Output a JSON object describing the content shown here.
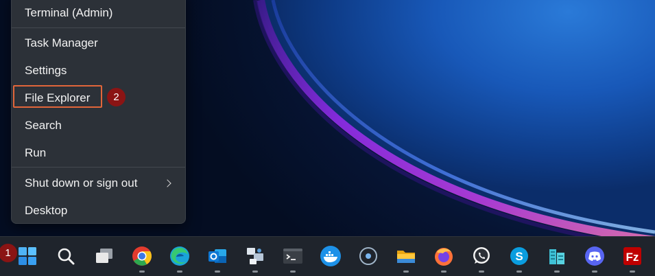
{
  "menu": {
    "items": [
      {
        "label": "Terminal (Admin)"
      },
      {
        "label": "Task Manager"
      },
      {
        "label": "Settings"
      },
      {
        "label": "File Explorer"
      },
      {
        "label": "Search"
      },
      {
        "label": "Run"
      },
      {
        "label": "Shut down or sign out"
      },
      {
        "label": "Desktop"
      }
    ]
  },
  "annotations": {
    "step1": "1",
    "step2": "2",
    "highlight_color": "#e2663a",
    "badge_color": "#8b1414"
  },
  "taskbar": {
    "background": "#1f242c",
    "icons": [
      {
        "name": "start-icon"
      },
      {
        "name": "search-icon"
      },
      {
        "name": "task-view-icon"
      },
      {
        "name": "chrome-icon"
      },
      {
        "name": "edge-icon"
      },
      {
        "name": "outlook-icon"
      },
      {
        "name": "network-app-icon"
      },
      {
        "name": "terminal-icon"
      },
      {
        "name": "docker-icon"
      },
      {
        "name": "cortana-icon"
      },
      {
        "name": "file-explorer-icon"
      },
      {
        "name": "firefox-icon"
      },
      {
        "name": "whatsapp-icon"
      },
      {
        "name": "skype-icon"
      },
      {
        "name": "buildings-app-icon"
      },
      {
        "name": "discord-icon"
      },
      {
        "name": "filezilla-icon"
      }
    ]
  }
}
